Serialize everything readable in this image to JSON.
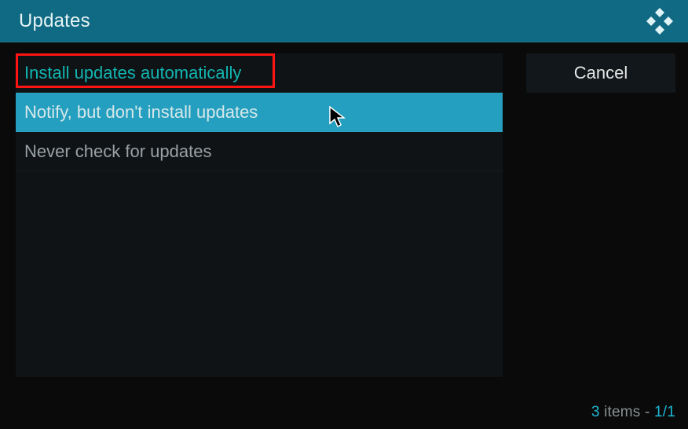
{
  "titlebar": {
    "title": "Updates"
  },
  "options": {
    "install_auto": {
      "label": "Install updates automatically"
    },
    "notify_only": {
      "label": "Notify, but don't install updates"
    },
    "never_check": {
      "label": "Never check for updates"
    }
  },
  "side": {
    "cancel_label": "Cancel"
  },
  "status": {
    "count": "3",
    "items_word": "items",
    "page": "1/1"
  },
  "colors": {
    "accent": "#1fb7d6",
    "selected_text": "#12B5B0",
    "highlight_bg": "#259fbf",
    "header_bg": "#116a83"
  }
}
